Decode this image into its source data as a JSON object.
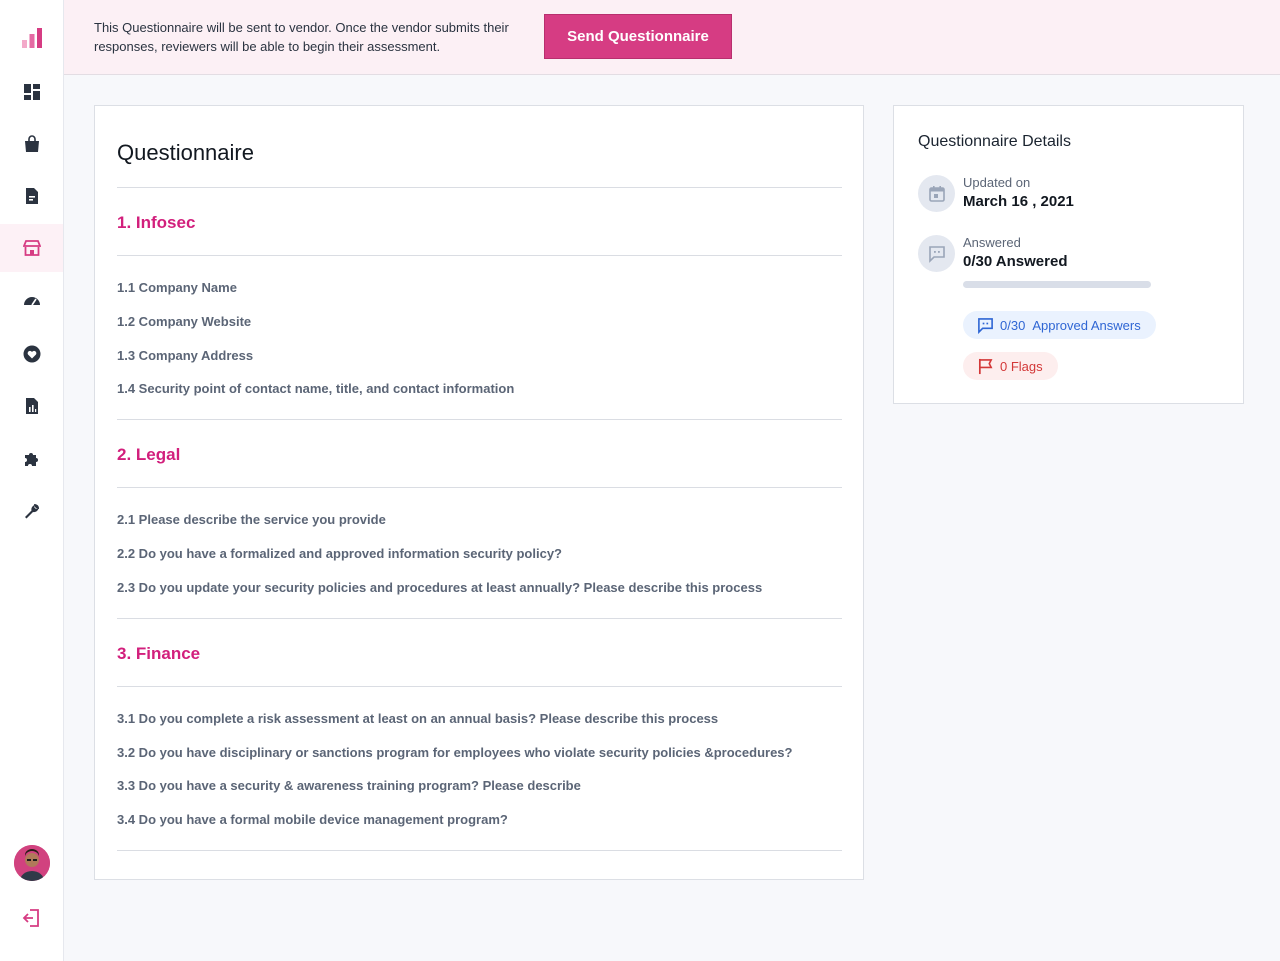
{
  "banner": {
    "message": "This Questionnaire will be sent to vendor. Once the vendor submits their responses, reviewers will be able to begin their assessment.",
    "send_button": "Send Questionnaire"
  },
  "sidebar": {
    "items": [
      {
        "name": "dashboard",
        "icon": "dashboard-icon"
      },
      {
        "name": "shopping",
        "icon": "shopping-bag-icon"
      },
      {
        "name": "documents",
        "icon": "document-icon"
      },
      {
        "name": "vendors",
        "icon": "store-icon",
        "active": true
      },
      {
        "name": "monitoring",
        "icon": "speedometer-icon"
      },
      {
        "name": "health",
        "icon": "heart-icon"
      },
      {
        "name": "reports",
        "icon": "report-icon"
      },
      {
        "name": "integrations",
        "icon": "puzzle-icon"
      },
      {
        "name": "settings",
        "icon": "wrench-icon"
      }
    ]
  },
  "questionnaire": {
    "title": "Questionnaire",
    "sections": [
      {
        "title": "1. Infosec",
        "questions": [
          "1.1 Company Name",
          "1.2 Company Website",
          "1.3 Company Address",
          "1.4 Security point of contact name, title, and contact information"
        ]
      },
      {
        "title": "2. Legal",
        "questions": [
          "2.1 Please describe the service you provide",
          "2.2 Do you have a formalized and approved information security policy?",
          "2.3 Do you update your security policies and procedures at least annually? Please describe this process"
        ]
      },
      {
        "title": "3. Finance",
        "questions": [
          "3.1 Do you complete a risk assessment at least on an annual basis? Please describe this process",
          "3.2 Do you have disciplinary or sanctions program for employees who violate security policies &procedures?",
          "3.3 Do you have a security & awareness training program? Please describe",
          "3.4 Do you have a formal mobile device management program?"
        ]
      }
    ]
  },
  "details": {
    "title": "Questionnaire Details",
    "updated_label": "Updated on",
    "updated_value": "March 16 , 2021",
    "answered_label": "Answered",
    "answered_value": "0/30 Answered",
    "answered_progress": 0,
    "approved_count": "0/30",
    "approved_label": "Approved Answers",
    "flags_label": "0 Flags"
  },
  "colors": {
    "accent": "#d63c83",
    "section_title": "#d21f7c",
    "banner_bg": "#fcf0f5",
    "approved": "#2f66d4",
    "flags": "#d33838"
  }
}
